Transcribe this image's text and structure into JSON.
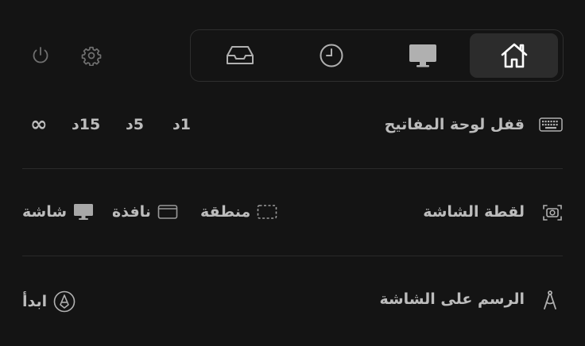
{
  "toolbar": {
    "left_icons": [
      "power-icon",
      "gear-icon"
    ],
    "tabs": [
      {
        "icon": "inbox-tray-icon",
        "active": false
      },
      {
        "icon": "clock-icon",
        "active": false
      },
      {
        "icon": "monitor-icon",
        "active": false
      },
      {
        "icon": "home-icon",
        "active": true
      }
    ]
  },
  "keyboard_lock": {
    "label": "قفل لوحة المفاتيح",
    "icon": "keyboard-icon",
    "options": [
      "1د",
      "5د",
      "15د",
      "∞"
    ]
  },
  "screenshot": {
    "label": "لقطة الشاشة",
    "icon": "camera-icon",
    "options": [
      {
        "label": "منطقة",
        "icon": "dashed-rect-icon"
      },
      {
        "label": "نافذة",
        "icon": "window-icon"
      },
      {
        "label": "شاشة",
        "icon": "monitor-icon"
      }
    ]
  },
  "draw": {
    "label": "الرسم على الشاشة",
    "icon": "compass-icon",
    "start_label": "ابدأ",
    "start_icon": "pen-circle-icon"
  },
  "colors": {
    "background": "#141414",
    "text": "#bcbcbc",
    "active_tab": "#2c2c2c",
    "border": "#2e2e2e"
  }
}
